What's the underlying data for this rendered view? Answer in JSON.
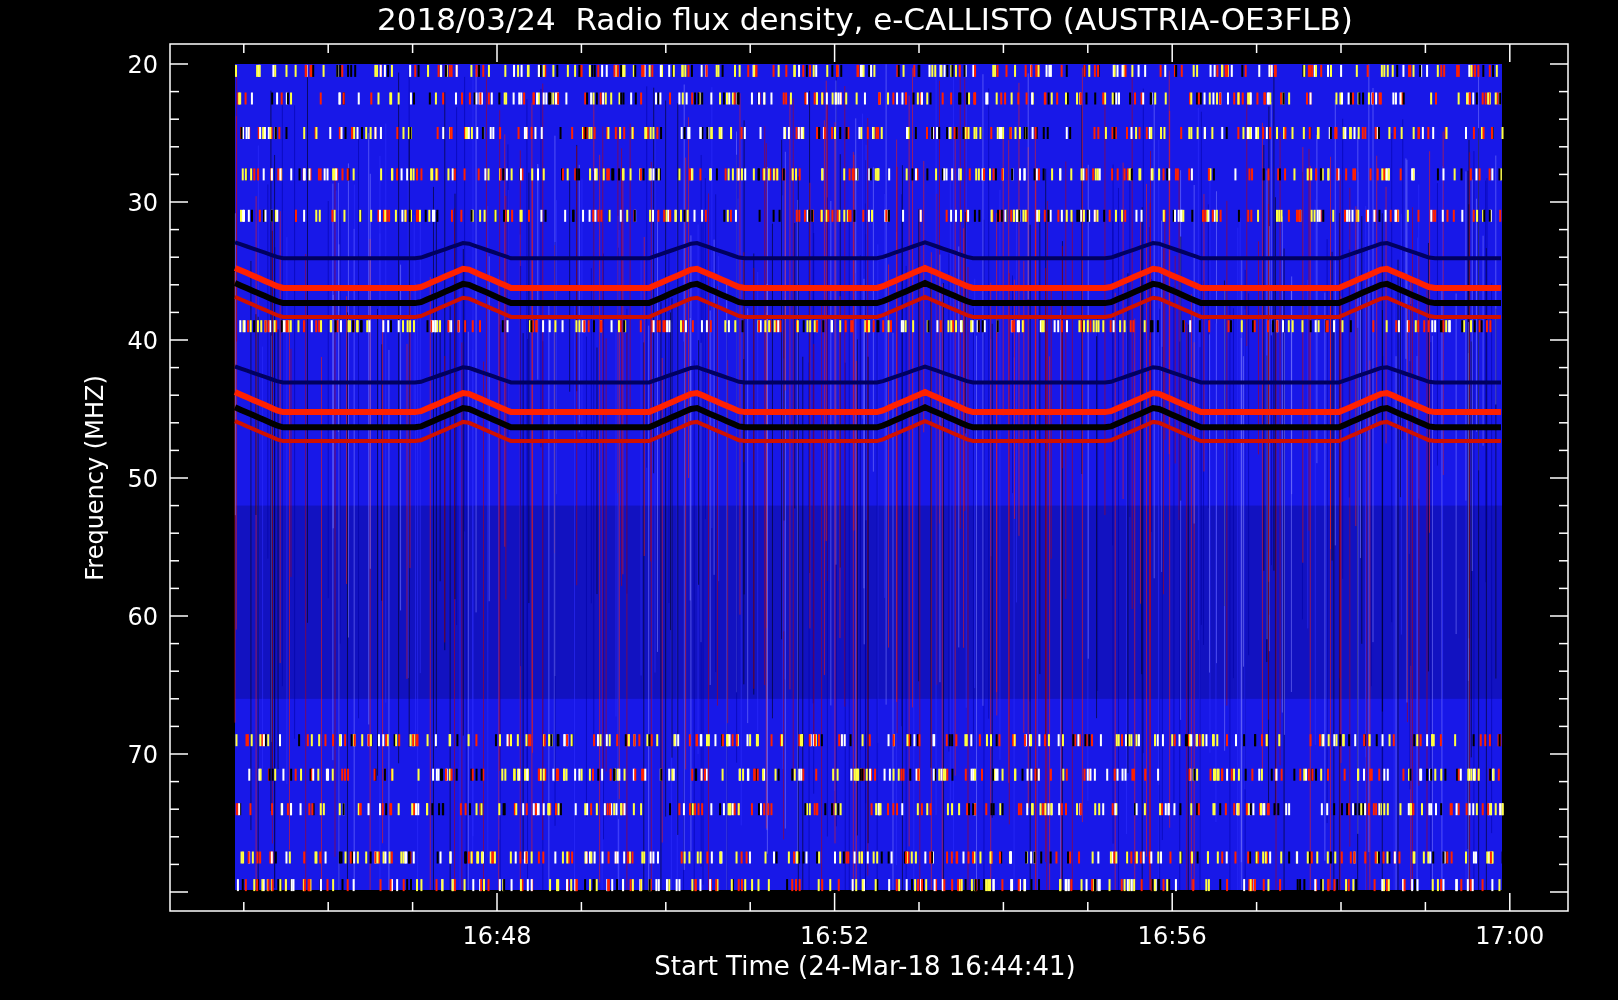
{
  "plot": {
    "title": "2018/03/24  Radio flux density, e-CALLISTO (AUSTRIA-OE3FLB)",
    "y_axis": {
      "label": "Frequency (MHZ)",
      "ticks": [
        "20",
        "30",
        "40",
        "50",
        "60",
        "70"
      ]
    },
    "x_axis": {
      "label": "Start Time (24-Mar-18 16:44:41)",
      "ticks": [
        "16:48",
        "16:52",
        "16:56",
        "17:00"
      ]
    }
  }
}
